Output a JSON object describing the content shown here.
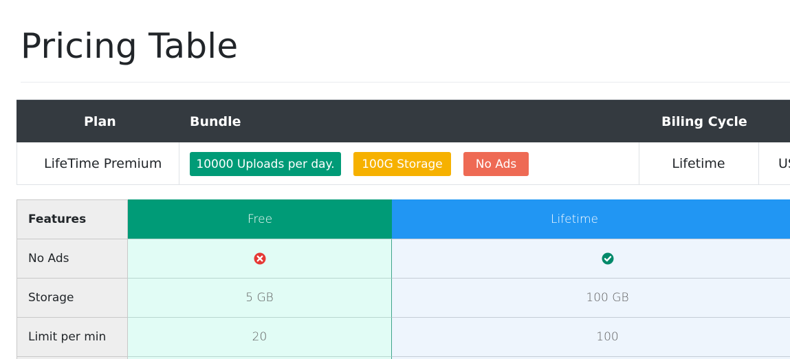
{
  "page": {
    "title": "Pricing Table"
  },
  "plan_table": {
    "headers": {
      "plan": "Plan",
      "bundle": "Bundle",
      "billing": "Biling Cycle"
    },
    "row": {
      "plan": "LifeTime Premium",
      "bundle": [
        {
          "label": "10000 Uploads per day.",
          "color": "#009b77"
        },
        {
          "label": "100G Storage",
          "color": "#f6b100"
        },
        {
          "label": "No Ads",
          "color": "#ee6a54"
        }
      ],
      "billing": "Lifetime",
      "price_partial": "US"
    }
  },
  "features_table": {
    "header": {
      "features": "Features",
      "free": "Free",
      "lifetime": "Lifetime"
    },
    "colors": {
      "free": "#009b77",
      "lifetime": "#2196f3",
      "no": "#e53935",
      "yes": "#00896a"
    },
    "rows": [
      {
        "feature": "No Ads",
        "free_icon": "cross-circle-icon",
        "lifetime_icon": "check-circle-icon"
      },
      {
        "feature": "Storage",
        "free": "5 GB",
        "lifetime": "100 GB"
      },
      {
        "feature": "Limit per min",
        "free": "20",
        "lifetime": "100"
      }
    ]
  }
}
